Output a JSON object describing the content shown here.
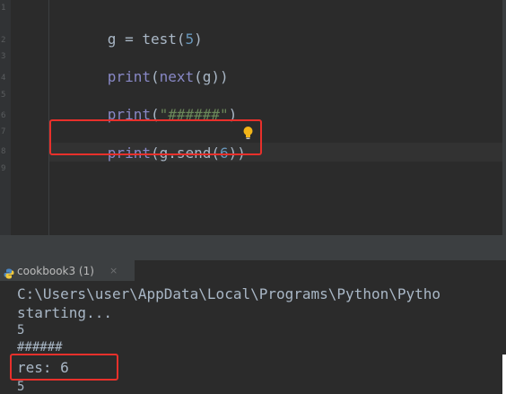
{
  "editor": {
    "line_numbers": [
      "1",
      "2",
      "3",
      "4",
      "5",
      "6",
      "7",
      "8",
      "9"
    ],
    "lines": [
      {
        "tokens": [
          {
            "text": "g = test(",
            "kind": "plain"
          },
          {
            "text": "5",
            "kind": "number"
          },
          {
            "text": ")",
            "kind": "plain"
          }
        ]
      },
      {
        "tokens": [
          {
            "text": "print",
            "kind": "builtin"
          },
          {
            "text": "(",
            "kind": "plain"
          },
          {
            "text": "next",
            "kind": "builtin"
          },
          {
            "text": "(g))",
            "kind": "plain"
          }
        ]
      },
      {
        "tokens": [
          {
            "text": "print",
            "kind": "builtin"
          },
          {
            "text": "(",
            "kind": "plain"
          },
          {
            "text": "\"######\"",
            "kind": "string"
          },
          {
            "text": ")",
            "kind": "plain"
          }
        ]
      },
      {
        "tokens": [
          {
            "text": "print",
            "kind": "builtin"
          },
          {
            "text": "(g.send(",
            "kind": "plain"
          },
          {
            "text": "6",
            "kind": "number"
          },
          {
            "text": "))",
            "kind": "plain"
          }
        ]
      }
    ],
    "intention_icon": "lightbulb-icon",
    "highlight_color": "#e8302b"
  },
  "run_tab": {
    "icon": "python-icon",
    "label": "cookbook3 (1)",
    "close_glyph": "×"
  },
  "console": {
    "lines": [
      "C:\\Users\\user\\AppData\\Local\\Programs\\Python\\Pytho",
      "starting...",
      "5",
      "######",
      "res: 6",
      "5"
    ]
  },
  "colors": {
    "background": "#2b2b2b",
    "gutter": "#313335",
    "text": "#a9b7c6",
    "builtin": "#8888c6",
    "number": "#6897bb",
    "string": "#6a8759",
    "bulb": "#f2b418"
  }
}
